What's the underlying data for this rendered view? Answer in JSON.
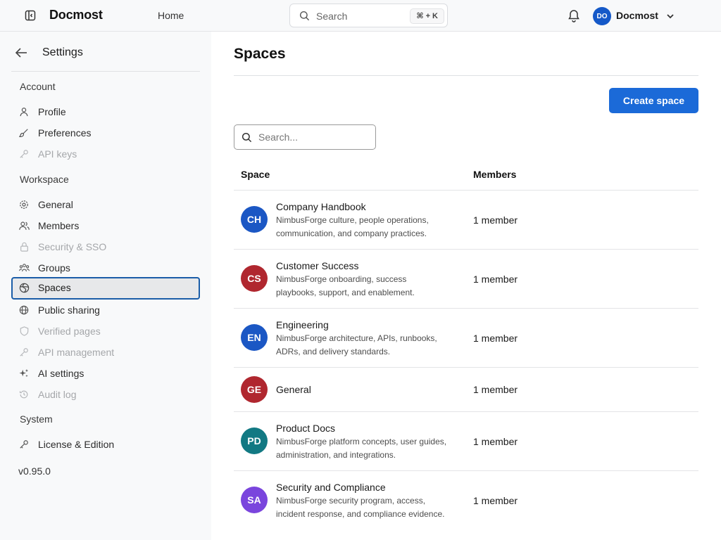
{
  "header": {
    "brand": "Docmost",
    "home_label": "Home",
    "search_label": "Search",
    "search_shortcut": "⌘ + K",
    "avatar_initials": "DO",
    "user_name": "Docmost"
  },
  "sidebar": {
    "title": "Settings",
    "sections": {
      "account": "Account",
      "workspace": "Workspace",
      "system": "System"
    },
    "items": {
      "profile": "Profile",
      "preferences": "Preferences",
      "api_keys": "API keys",
      "general": "General",
      "members": "Members",
      "security_sso": "Security & SSO",
      "groups": "Groups",
      "spaces": "Spaces",
      "public_sharing": "Public sharing",
      "verified_pages": "Verified pages",
      "api_management": "API management",
      "ai_settings": "AI settings",
      "audit_log": "Audit log",
      "license_edition": "License & Edition"
    },
    "version": "v0.95.0"
  },
  "main": {
    "title": "Spaces",
    "create_button": "Create space",
    "search_placeholder": "Search...",
    "columns": {
      "space": "Space",
      "members": "Members"
    },
    "spaces": [
      {
        "initials": "CH",
        "color": "#1b57c4",
        "name": "Company Handbook",
        "desc1": "NimbusForge culture, people operations,",
        "desc2": "communication, and company practices.",
        "members": "1 member"
      },
      {
        "initials": "CS",
        "color": "#b0272f",
        "name": "Customer Success",
        "desc1": "NimbusForge onboarding, success",
        "desc2": "playbooks, support, and enablement.",
        "members": "1 member"
      },
      {
        "initials": "EN",
        "color": "#1b57c4",
        "name": "Engineering",
        "desc1": "NimbusForge architecture, APIs, runbooks,",
        "desc2": "ADRs, and delivery standards.",
        "members": "1 member"
      },
      {
        "initials": "GE",
        "color": "#b0272f",
        "name": "General",
        "desc1": "",
        "desc2": "",
        "members": "1 member"
      },
      {
        "initials": "PD",
        "color": "#127983",
        "name": "Product Docs",
        "desc1": "NimbusForge platform concepts, user guides,",
        "desc2": "administration, and integrations.",
        "members": "1 member"
      },
      {
        "initials": "SA",
        "color": "#7a45dd",
        "name": "Security and Compliance",
        "desc1": "NimbusForge security program, access,",
        "desc2": "incident response, and compliance evidence.",
        "members": "1 member"
      }
    ]
  }
}
